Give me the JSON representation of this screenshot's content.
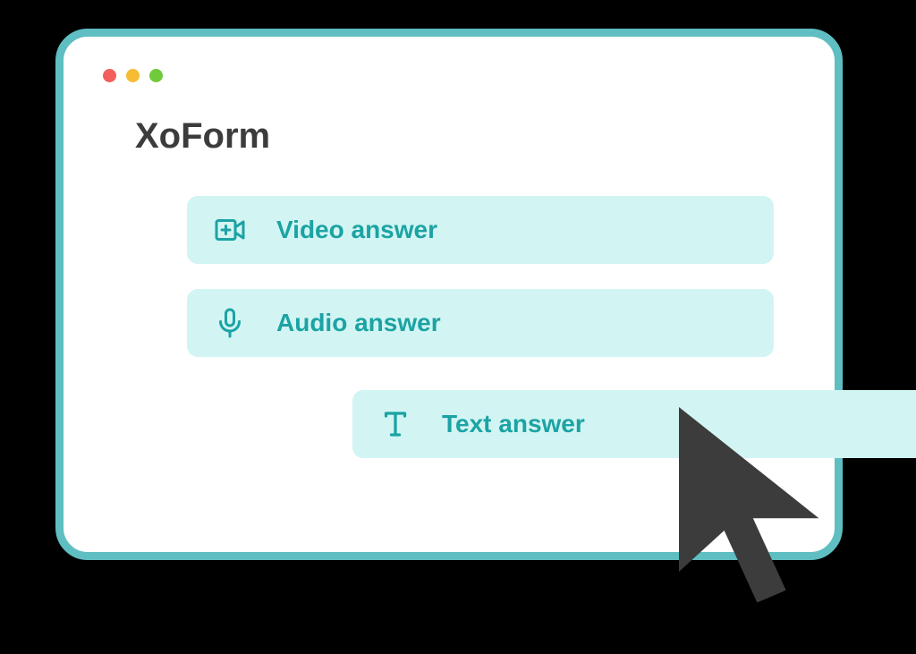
{
  "app": {
    "title": "XoForm"
  },
  "options": [
    {
      "label": "Video answer",
      "icon": "video-add-icon"
    },
    {
      "label": "Audio answer",
      "icon": "microphone-icon"
    },
    {
      "label": "Text answer",
      "icon": "text-icon"
    }
  ],
  "colors": {
    "window_border": "#5fbec2",
    "option_bg": "#d2f5f4",
    "accent_text": "#1ca3a3",
    "title_text": "#3c3c3c",
    "cursor": "#3c3c3c"
  }
}
